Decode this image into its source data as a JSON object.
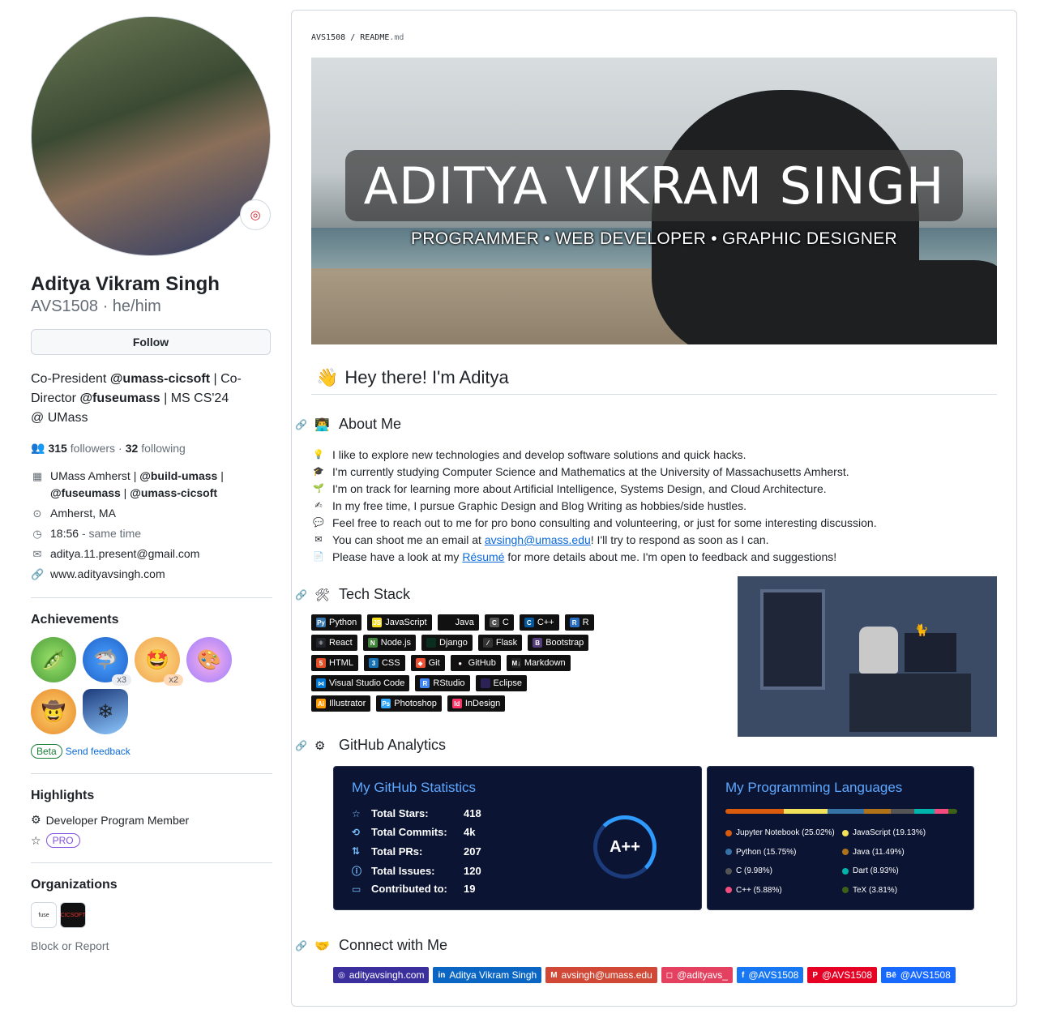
{
  "profile": {
    "name": "Aditya Vikram Singh",
    "login": "AVS1508 · he/him",
    "follow_label": "Follow",
    "bio_parts": [
      "Co-President ",
      "@umass-cicsoft",
      " | Co-Director ",
      "@fuseumass",
      " | MS CS'24 @ UMass"
    ],
    "followers_count": "315",
    "followers_label": "followers",
    "sep": "·",
    "following_count": "32",
    "following_label": "following",
    "org_line_1": "UMass Amherst | ",
    "org_line_2": "@build-umass",
    "org_line_3": " |",
    "org_line_4": "@fuseumass",
    "org_line_5": " | ",
    "org_line_6": "@umass-cicsoft",
    "location": "Amherst, MA",
    "time": "18:56",
    "time_suffix": "- same time",
    "email": "aditya.11.present@gmail.com",
    "website": "www.adityavsingh.com"
  },
  "achievements": {
    "title": "Achievements",
    "items": [
      {
        "name": "peas",
        "count": ""
      },
      {
        "name": "shark",
        "count": "x3"
      },
      {
        "name": "starstruck",
        "count": "x2"
      },
      {
        "name": "yolo",
        "count": ""
      },
      {
        "name": "cowboy",
        "count": ""
      },
      {
        "name": "arctic",
        "count": ""
      }
    ],
    "beta_label": "Beta",
    "feedback_label": "Send feedback"
  },
  "highlights": {
    "title": "Highlights",
    "member_label": "Developer Program Member",
    "pro_label": "PRO"
  },
  "organizations": {
    "title": "Organizations",
    "orgs": [
      "fuse",
      "CICSOFT"
    ],
    "block_label": "Block or Report"
  },
  "readme": {
    "crumb_user": "AVS1508",
    "crumb_sep": "/",
    "crumb_file": "README",
    "crumb_ext": ".md",
    "banner_title": "ADITYA VIKRAM SINGH",
    "banner_subtitle": "PROGRAMMER • WEB DEVELOPER • GRAPHIC DESIGNER",
    "greeting": "Hey there! I'm Aditya",
    "about_title": "About Me",
    "about_items": [
      {
        "icon": "bulb",
        "text": "I like to explore new technologies and develop software solutions and quick hacks."
      },
      {
        "icon": "grad-cap",
        "text": "I'm currently studying Computer Science and Mathematics at the University of Massachusetts Amherst."
      },
      {
        "icon": "seedling",
        "text": "I'm on track for learning more about Artificial Intelligence, Systems Design, and Cloud Architecture."
      },
      {
        "icon": "writing-hand",
        "text": "In my free time, I pursue Graphic Design and Blog Writing as hobbies/side hustles."
      },
      {
        "icon": "speech-bubble",
        "text": "Feel free to reach out to me for pro bono consulting and volunteering, or just for some interesting discussion."
      }
    ],
    "email_pre": "You can shoot me an email at ",
    "email_link": "avsingh@umass.edu",
    "email_post": "! I'll try to respond as soon as I can.",
    "resume_pre": "Please have a look at my ",
    "resume_link": "Résumé",
    "resume_post": " for more details about me. I'm open to feedback and suggestions!",
    "tech_title": "Tech Stack",
    "tech_rows": [
      [
        {
          "label": "Python",
          "color": "#3776ab",
          "ico": "Py"
        },
        {
          "label": "JavaScript",
          "color": "#f7df1e",
          "ico": "JS"
        },
        {
          "label": "Java",
          "color": "#111",
          "ico": ""
        },
        {
          "label": "C",
          "color": "#555",
          "ico": "C"
        },
        {
          "label": "C++",
          "color": "#00599c",
          "ico": "C"
        },
        {
          "label": "R",
          "color": "#276dc3",
          "ico": "R"
        }
      ],
      [
        {
          "label": "React",
          "color": "#20232a",
          "ico": "⚛"
        },
        {
          "label": "Node.js",
          "color": "#43853d",
          "ico": "N"
        },
        {
          "label": "Django",
          "color": "#092e20",
          "ico": ""
        },
        {
          "label": "Flask",
          "color": "#333",
          "ico": "⁄"
        },
        {
          "label": "Bootstrap",
          "color": "#563d7c",
          "ico": "B"
        }
      ],
      [
        {
          "label": "HTML",
          "color": "#e34f26",
          "ico": "5"
        },
        {
          "label": "CSS",
          "color": "#1572b6",
          "ico": "3"
        },
        {
          "label": "Git",
          "color": "#f05033",
          "ico": "◆"
        },
        {
          "label": "GitHub",
          "color": "#121011",
          "ico": "●"
        },
        {
          "label": "Markdown",
          "color": "#222",
          "ico": "M↓"
        }
      ],
      [
        {
          "label": "Visual Studio Code",
          "color": "#0078d7",
          "ico": "⋈"
        },
        {
          "label": "RStudio",
          "color": "#4285f4",
          "ico": "R"
        },
        {
          "label": "Eclipse",
          "color": "#2c2255",
          "ico": ""
        }
      ],
      [
        {
          "label": "Illustrator",
          "color": "#ff9a00",
          "ico": "Ai"
        },
        {
          "label": "Photoshop",
          "color": "#31a8ff",
          "ico": "Ps"
        },
        {
          "label": "InDesign",
          "color": "#ff3366",
          "ico": "Id"
        }
      ]
    ],
    "analytics_title": "GitHub Analytics",
    "stats_title": "My GitHub Statistics",
    "stats": [
      {
        "label": "Total Stars:",
        "value": "418",
        "icon": "star-icon",
        "glyph": "☆"
      },
      {
        "label": "Total Commits:",
        "value": "4k",
        "icon": "history-icon",
        "glyph": "⟲"
      },
      {
        "label": "Total PRs:",
        "value": "207",
        "icon": "pr-icon",
        "glyph": "⇅"
      },
      {
        "label": "Total Issues:",
        "value": "120",
        "icon": "issue-icon",
        "glyph": "ⓘ"
      },
      {
        "label": "Contributed to:",
        "value": "19",
        "icon": "repo-icon",
        "glyph": "▭"
      }
    ],
    "grade": "A++",
    "lang_title": "My Programming Languages",
    "languages": [
      {
        "label": "Jupyter Notebook (25.02%)",
        "pct": 25.02,
        "color": "#DA5B0B"
      },
      {
        "label": "JavaScript (19.13%)",
        "pct": 19.13,
        "color": "#f1e05a"
      },
      {
        "label": "Python (15.75%)",
        "pct": 15.75,
        "color": "#3572A5"
      },
      {
        "label": "Java (11.49%)",
        "pct": 11.49,
        "color": "#b07219"
      },
      {
        "label": "C (9.98%)",
        "pct": 9.98,
        "color": "#555555"
      },
      {
        "label": "Dart (8.93%)",
        "pct": 8.93,
        "color": "#00B4AB"
      },
      {
        "label": "C++ (5.88%)",
        "pct": 5.88,
        "color": "#f34b7d"
      },
      {
        "label": "TeX (3.81%)",
        "pct": 3.81,
        "color": "#3D6117"
      }
    ],
    "connect_title": "Connect with Me",
    "socials": [
      {
        "label": "adityavsingh.com",
        "color": "#3b2f9e",
        "ico": "◎",
        "name": "website"
      },
      {
        "label": "Aditya Vikram Singh",
        "color": "#0a66c2",
        "ico": "in",
        "name": "linkedin"
      },
      {
        "label": "avsingh@umass.edu",
        "color": "#d14836",
        "ico": "M",
        "name": "gmail"
      },
      {
        "label": "@adityavs_",
        "color": "#e4405f",
        "ico": "◻",
        "name": "instagram"
      },
      {
        "label": "@AVS1508",
        "color": "#1877f2",
        "ico": "f",
        "name": "facebook"
      },
      {
        "label": "@AVS1508",
        "color": "#e60023",
        "ico": "P",
        "name": "pinterest"
      },
      {
        "label": "@AVS1508",
        "color": "#1769ff",
        "ico": "Bē",
        "name": "behance"
      }
    ]
  }
}
